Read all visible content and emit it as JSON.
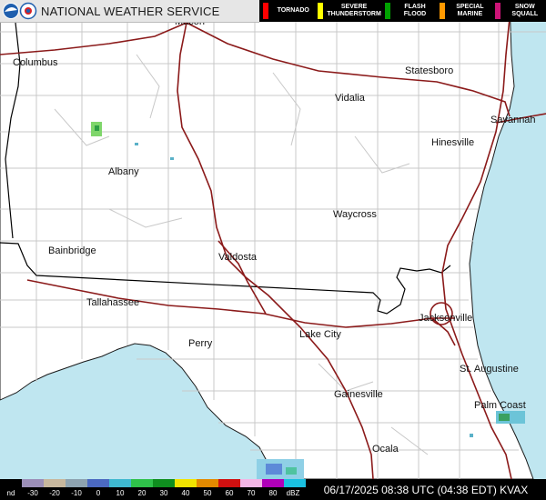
{
  "header": {
    "title": "NATIONAL WEATHER SERVICE"
  },
  "icons": {
    "noaa_logo": "noaa-logo-icon",
    "nws_logo": "nws-logo-icon"
  },
  "warnings": [
    {
      "label": "TORNADO",
      "color": "#ff0000"
    },
    {
      "label": "SEVERE\nTHUNDERSTORM",
      "color": "#ffff00"
    },
    {
      "label": "FLASH\nFLOOD",
      "color": "#00a000"
    },
    {
      "label": "SPECIAL\nMARINE",
      "color": "#ff9900"
    },
    {
      "label": "SNOW\nSQUALL",
      "color": "#cc1477"
    }
  ],
  "cities": [
    "Macon",
    "Columbus",
    "Statesboro",
    "Vidalia",
    "Savannah",
    "Hinesville",
    "Albany",
    "Waycross",
    "Bainbridge",
    "Valdosta",
    "Tallahassee",
    "Jacksonville",
    "Lake City",
    "Perry",
    "St. Augustine",
    "Gainesville",
    "Palm Coast",
    "Ocala"
  ],
  "scale": {
    "unit_label": "dBZ",
    "nd_label": "nd",
    "tick_labels": [
      "-30",
      "-20",
      "-10",
      "0",
      "10",
      "20",
      "30",
      "40",
      "50",
      "60",
      "70",
      "80"
    ]
  },
  "timestamp": "06/17/2025 08:38 UTC (04:38 EDT) KVAX",
  "colors": {
    "water": "#bfe6f0",
    "land": "#ffffff",
    "county_lines": "#c8c8c8",
    "interstates": "#8b1a1a",
    "state_line": "#000000"
  }
}
